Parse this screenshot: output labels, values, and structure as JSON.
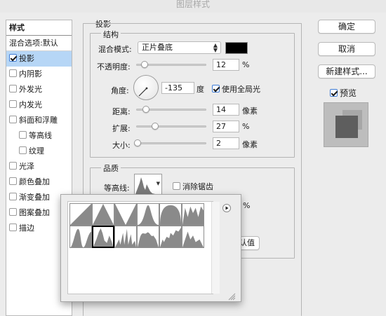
{
  "window": {
    "title": "图层样式"
  },
  "styles_panel": {
    "header": "样式",
    "blend_label": "混合选项:默认",
    "items": [
      {
        "label": "投影",
        "checked": true,
        "selected": true,
        "indent": false
      },
      {
        "label": "内阴影",
        "checked": false,
        "selected": false,
        "indent": false
      },
      {
        "label": "外发光",
        "checked": false,
        "selected": false,
        "indent": false
      },
      {
        "label": "内发光",
        "checked": false,
        "selected": false,
        "indent": false
      },
      {
        "label": "斜面和浮雕",
        "checked": false,
        "selected": false,
        "indent": false
      },
      {
        "label": "等高线",
        "checked": false,
        "selected": false,
        "indent": true
      },
      {
        "label": "纹理",
        "checked": false,
        "selected": false,
        "indent": true
      },
      {
        "label": "光泽",
        "checked": false,
        "selected": false,
        "indent": false
      },
      {
        "label": "颜色叠加",
        "checked": false,
        "selected": false,
        "indent": false
      },
      {
        "label": "渐变叠加",
        "checked": false,
        "selected": false,
        "indent": false
      },
      {
        "label": "图案叠加",
        "checked": false,
        "selected": false,
        "indent": false
      },
      {
        "label": "描边",
        "checked": false,
        "selected": false,
        "indent": false
      }
    ]
  },
  "drop_shadow": {
    "title": "投影",
    "structure": {
      "title": "结构",
      "blend_mode_label": "混合模式:",
      "blend_mode_value": "正片叠底",
      "color": "#000000",
      "opacity_label": "不透明度:",
      "opacity_value": "12",
      "opacity_fraction": 0.12,
      "percent_unit": "%",
      "angle_label": "角度:",
      "angle_value": "-135",
      "angle_unit": "度",
      "global_light_label": "使用全局光",
      "global_light_checked": true,
      "distance_label": "距离:",
      "distance_value": "14",
      "pixel_unit": "像素",
      "spread_label": "扩展:",
      "spread_value": "27",
      "size_label": "大小:",
      "size_value": "2"
    },
    "quality": {
      "title": "品质",
      "contour_label": "等高线:",
      "antialias_label": "消除锯齿",
      "antialias_checked": false,
      "noise_unit": "%",
      "reset_default_partial": "认值"
    }
  },
  "buttons": {
    "ok": "确定",
    "cancel": "取消",
    "new_style": "新建样式...",
    "preview_label": "预览",
    "preview_checked": true
  },
  "contour_picker": {
    "menu_icon": "play-circle-icon",
    "resize_icon": "resize-grip-icon",
    "presets": [
      "linear",
      "cone",
      "cone-inverted",
      "gaussian",
      "half-round",
      "ring",
      "ring-double",
      "rounded-steps",
      "sawtooth",
      "cove-deep",
      "cove-shallow",
      "rolling-slope"
    ],
    "selected_index": 7
  }
}
